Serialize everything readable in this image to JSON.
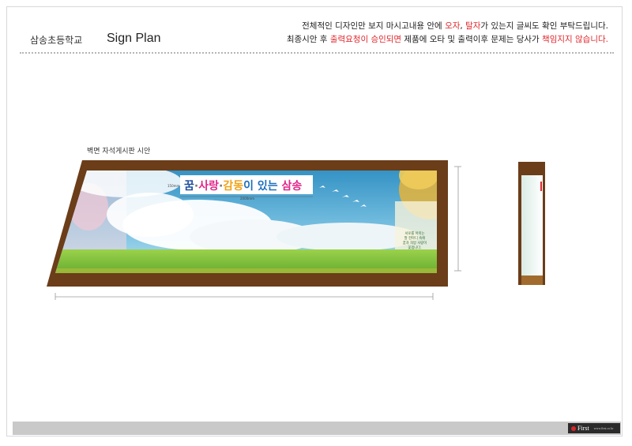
{
  "header": {
    "school_name": "삼송초등학교",
    "plan_title": "Sign Plan",
    "notice_line1": [
      {
        "text": "전체적인 디자인만 보지 마시고내용 안에 ",
        "red": false
      },
      {
        "text": "오자",
        "red": true
      },
      {
        "text": ", ",
        "red": false
      },
      {
        "text": "탈자",
        "red": true
      },
      {
        "text": "가 있는지 글씨도 확인 부탁드립니다.",
        "red": false
      }
    ],
    "notice_line2": [
      {
        "text": "최종시안 후 ",
        "red": false
      },
      {
        "text": "출력요청이 승인되면",
        "red": true
      },
      {
        "text": " 제품에 오타 및 출력이후 문제는 당사가 ",
        "red": false
      },
      {
        "text": "책임지지 않습니다.",
        "red": true
      }
    ]
  },
  "sign": {
    "label": "벽면 자석게시판 시안",
    "banner_parts": [
      {
        "text": "꿈",
        "color": "#1f4fa0"
      },
      {
        "text": "·",
        "color": "#777777"
      },
      {
        "text": "사랑",
        "color": "#e0268a"
      },
      {
        "text": "·",
        "color": "#777777"
      },
      {
        "text": "감동",
        "color": "#f0a317"
      },
      {
        "text": "이 있는 ",
        "color": "#1d6fbd"
      },
      {
        "text": "삼송",
        "color": "#e0268a"
      }
    ],
    "dim_height": "150mm",
    "dim_width": "2000mm",
    "note_lines": [
      "서로를 아끼는",
      "말 한마디 속에",
      "꿈과 희망 사랑이",
      "꽃핍니다."
    ]
  },
  "colors": {
    "frame_brown": "#6b3d19",
    "sky": "#3d9bc9",
    "grass": "#7ec23a",
    "accent_red": "#e0262b"
  },
  "footer": {
    "logo_text": "First",
    "logo_sub": "www.first.co.kr"
  }
}
